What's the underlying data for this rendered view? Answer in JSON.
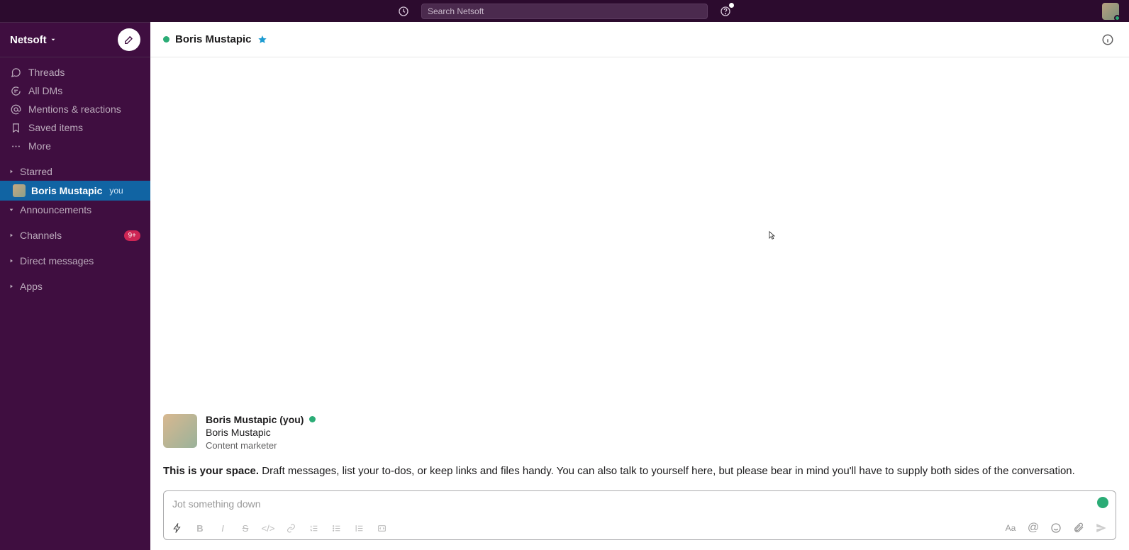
{
  "search": {
    "placeholder": "Search Netsoft"
  },
  "workspace": {
    "name": "Netsoft"
  },
  "nav": {
    "threads": "Threads",
    "alldms": "All DMs",
    "mentions": "Mentions & reactions",
    "saved": "Saved items",
    "more": "More"
  },
  "sections": {
    "starred": "Starred",
    "announcements": "Announcements",
    "channels": "Channels",
    "channels_badge": "9+",
    "dms": "Direct messages",
    "apps": "Apps"
  },
  "starred_item": {
    "name": "Boris Mustapic",
    "you": "you"
  },
  "header": {
    "title": "Boris Mustapic"
  },
  "intro": {
    "name_you": "Boris Mustapic (you)",
    "name": "Boris Mustapic",
    "role": "Content marketer",
    "bold": "This is your space.",
    "rest": " Draft messages, list your to-dos, or keep links and files handy. You can also talk to yourself here, but please bear in mind you'll have to supply both sides of the conversation."
  },
  "composer": {
    "placeholder": "Jot something down"
  }
}
